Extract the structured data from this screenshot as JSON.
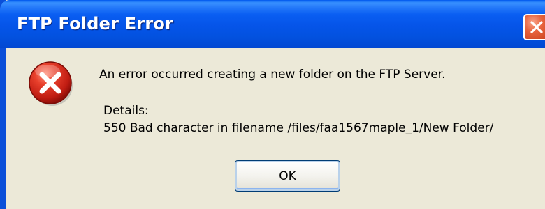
{
  "window": {
    "title": "FTP Folder Error"
  },
  "dialog": {
    "icon": "error-icon",
    "message": "An error occurred creating a new folder on the FTP Server.",
    "details_label": "Details:",
    "details_text": "550 Bad character in filename /files/faa1567maple_1/New Folder/"
  },
  "buttons": {
    "ok_label": "OK"
  },
  "colors": {
    "titlebar": "#0554e8",
    "dialog_background": "#ece9d8",
    "close_button": "#e8643e",
    "error_icon": "#d2261a"
  }
}
